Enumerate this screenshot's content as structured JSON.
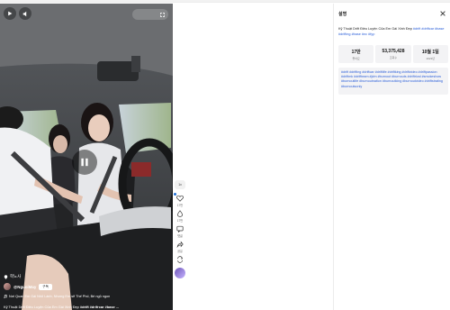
{
  "video": {
    "location": "학노사",
    "author": "@NguoiMay",
    "follow_label": "구독",
    "music": "Nơi Quan Em Gái Nhỏ Lành, Nhưng Em sẽ Thế Phố, Bé ngủ ngon",
    "caption_text": "Kỹ Thuật Drift Điều Luyện Của Em Gái Xinh Đẹp",
    "caption_tags": "#drift #drifrcar #base ..."
  },
  "rail": {
    "speed_label": "1x",
    "like_count": "17만",
    "comment_count": "댓글",
    "save_count": "공유",
    "share_count": "공유"
  },
  "panel": {
    "title": "설명",
    "description": "Kỹ Thuật Drift Điều Luyện Của Em Gái Xinh Đẹp",
    "description_tags": "#drift #driftcar #base #drifting #base #nc #fyp",
    "stats": [
      {
        "value": "17만",
        "label": "좋아요"
      },
      {
        "value": "53,375,428",
        "label": "조회수"
      },
      {
        "value": "10월 1일",
        "label": "2023년"
      }
    ],
    "tags": "#drift #drifting #driftcar #driftlife #driftking #driftvideo #driftpassion #driftmk #driftteam #jdm #burnout #burnouts #driftrival #smokeshow #burnoutlife #burnoutnation #burnoutking #burnoutvideo #driftstrating #burnoutsonly"
  },
  "colors": {
    "accent": "#2b5fd9",
    "panel_bg": "#f3f3f5",
    "avatar_rail": "#6e56b8"
  }
}
